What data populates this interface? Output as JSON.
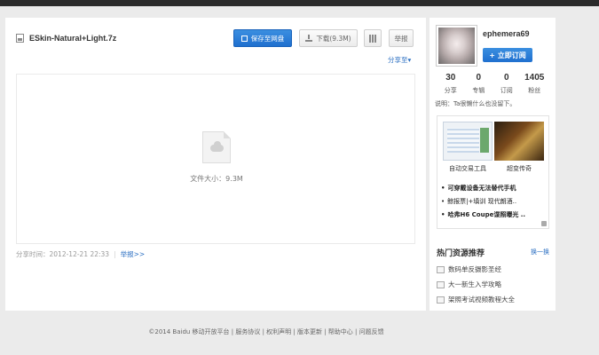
{
  "file": {
    "name": "ESkin-Natural+Light.7z",
    "save_label": "保存至网盘",
    "download_label": "下载(9.3M)",
    "report_label": "举报",
    "share_to_label": "分享至",
    "size_text": "文件大小：9.3M",
    "share_time_text": "分享时间：2012-12-21 22:33",
    "report_link": "举报>>"
  },
  "user": {
    "name": "ephemera69",
    "subscribe_label": "+ 立即订阅",
    "stats": [
      {
        "num": "30",
        "label": "分享"
      },
      {
        "num": "0",
        "label": "专辑"
      },
      {
        "num": "0",
        "label": "订阅"
      },
      {
        "num": "1405",
        "label": "粉丝"
      }
    ],
    "bio": "说明：Ta很懒什么也没留下。"
  },
  "ad": {
    "caption1": "自动交易工具",
    "caption2": "超变传奇",
    "items": [
      {
        "text": "可穿戴设备无法替代手机",
        "bold": true
      },
      {
        "text": "鲸报票|+填训   现代朗酒..",
        "bold": false
      },
      {
        "text": "哈弗H6 Coupe谍照曝光 ..",
        "bold": true
      }
    ]
  },
  "hot": {
    "title": "热门资源推荐",
    "switch_label": "换一换",
    "items": [
      "数码单反摄影圣经",
      "大一新生入学攻略",
      "架照考试视频教程大全"
    ]
  },
  "footer": {
    "text": "©2014 Baidu 移动开放平台 | 服务协议 | 权利声明 | 版本更新 | 帮助中心 | 问题反馈"
  }
}
